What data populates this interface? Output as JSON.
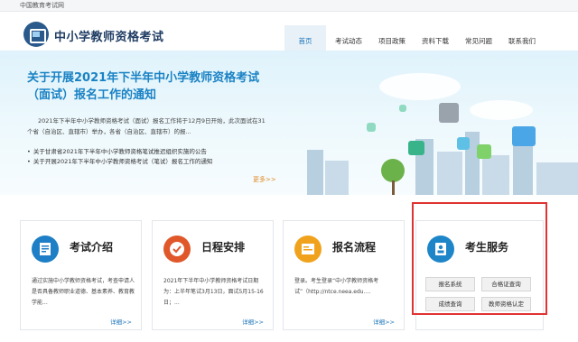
{
  "top_bar": {
    "text": "中国教育考试网"
  },
  "header": {
    "site_title": "中小学教师资格考试",
    "nav": [
      "首页",
      "考试动态",
      "项目政策",
      "资料下载",
      "常见问题",
      "联系我们"
    ]
  },
  "banner": {
    "title": "关于开展2021年下半年中小学教师资格考试（面试）报名工作的通知",
    "body": "2021年下半年中小学教师资格考试（面试）报名工作将于12月9日开始，此次面试在31个省（自治区、直辖市）举办，各省（自治区、直辖市）的报...",
    "list": [
      "关于甘肃省2021年下半年中小学教师资格笔试推迟组织实施的公告",
      "关于开展2021年下半年中小学教师资格考试（笔试）报名工作的通知"
    ],
    "more": "更多>>"
  },
  "cards": [
    {
      "label": "考试介绍",
      "desc": "通过实施中小学教师资格考试，考查申请人是否具备教师职业道德、基本素养、教育教学能...",
      "detail": "详细>>"
    },
    {
      "label": "日程安排",
      "desc": "2021年下半年中小学教师资格考试日期为：上半年笔试3月13日，面试5月15-16日；...",
      "detail": "详细>>"
    },
    {
      "label": "报名流程",
      "desc": "登录。考生登录“中小学教师资格考试”（http://ntce.neea.edu....",
      "detail": "详细>>"
    }
  ],
  "service": {
    "label": "考生服务",
    "buttons": [
      "报名系统",
      "合格证查询",
      "成绩查询",
      "教师资格认定"
    ]
  },
  "colors": {
    "accent": "#1b74b9",
    "title_blue": "#1a82c4",
    "highlight": "#e03232",
    "more_orange": "#e08b28"
  }
}
